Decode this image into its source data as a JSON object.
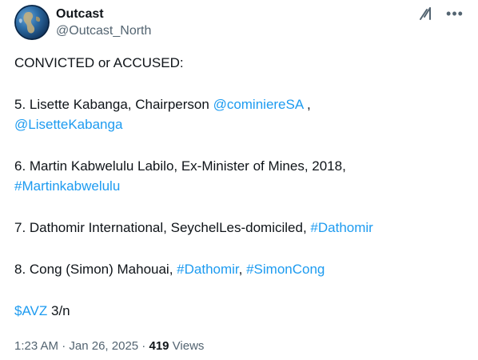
{
  "author": {
    "display_name": "Outcast",
    "handle": "@Outcast_North",
    "avatar_icon": "globe-avatar"
  },
  "actions": {
    "grok_icon": "grok-icon",
    "more_icon": "more-icon",
    "more_glyph": "•••"
  },
  "tweet": {
    "line_heading": "CONVICTED  or  ACCUSED:",
    "item5": {
      "text": "5. Lisette Kabanga, Chairperson ",
      "mention1": "@cominiereSA",
      "sep": " ,",
      "mention2": "@LisetteKabanga"
    },
    "item6": {
      "text": "6. Martin Kabwelulu Labilo, Ex-Minister of Mines, 2018,",
      "hashtag": "#Martinkabwelulu"
    },
    "item7": {
      "text": "7. Dathomir International, SeychelLes-domiciled, ",
      "hashtag": "#Dathomir"
    },
    "item8": {
      "text": "8. Cong (Simon) Mahouai, ",
      "hashtag1": "#Dathomir",
      "sep": ", ",
      "hashtag2": "#SimonCong"
    },
    "footer_line": {
      "cashtag": "$AVZ",
      "suffix": " 3/n"
    }
  },
  "meta": {
    "time": "1:23 AM",
    "dot1": " · ",
    "date": "Jan 26, 2025",
    "dot2": " · ",
    "views_count": "419",
    "views_label": " Views"
  },
  "colors": {
    "link": "#1d9bf0",
    "text": "#0f1419",
    "secondary": "#536471"
  }
}
